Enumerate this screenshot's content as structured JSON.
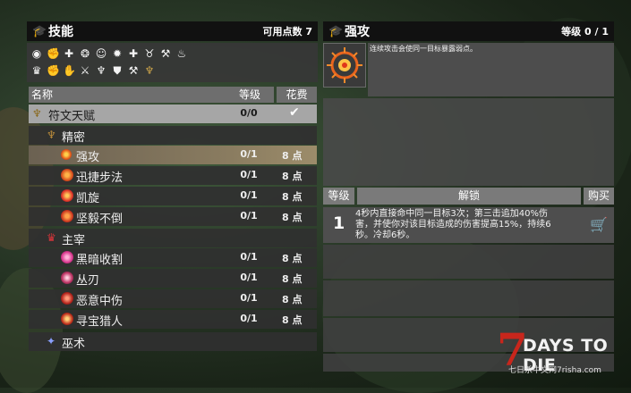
{
  "skills_panel": {
    "title": "技能",
    "points_label": "可用点数 7",
    "category_icons": [
      "eye-icon",
      "flex-arm-icon",
      "medical-cross-icon",
      "brain-icon",
      "head-gear-icon",
      "gear-icon",
      "medical-plus-icon",
      "cow-icon",
      "pickaxe-icon",
      "flame-icon",
      "hat-icon",
      "fist-icon",
      "fist-up-icon",
      "hammer-strike-icon",
      "grass-icon",
      "shield-icon",
      "hammer-icon",
      "rune-icon"
    ],
    "columns": {
      "name": "名称",
      "level": "等级",
      "cost": "花费"
    },
    "rows": [
      {
        "name": "符文天赋",
        "level": "0/0",
        "cost": "",
        "kind": "attribute",
        "icon": "rune-icon"
      },
      {
        "name": "精密",
        "level": "",
        "cost": "",
        "kind": "skill",
        "icon": "rune-small-icon"
      },
      {
        "name": "强攻",
        "level": "0/1",
        "cost": "8 点",
        "kind": "perk",
        "icon": "sun-sigil-icon",
        "selected": true
      },
      {
        "name": "迅捷步法",
        "level": "0/1",
        "cost": "8 点",
        "kind": "perk",
        "icon": "lightning-icon"
      },
      {
        "name": "凯旋",
        "level": "0/1",
        "cost": "8 点",
        "kind": "perk",
        "icon": "triumph-icon"
      },
      {
        "name": "坚毅不倒",
        "level": "0/1",
        "cost": "8 点",
        "kind": "perk",
        "icon": "figure-icon"
      },
      {
        "name": "主宰",
        "level": "",
        "cost": "",
        "kind": "skill",
        "icon": "domination-icon"
      },
      {
        "name": "黑暗收割",
        "level": "0/1",
        "cost": "8 点",
        "kind": "perk",
        "icon": "flame-pink-icon"
      },
      {
        "name": "丛刃",
        "level": "0/1",
        "cost": "8 点",
        "kind": "perk",
        "icon": "swirl-icon"
      },
      {
        "name": "恶意中伤",
        "level": "0/1",
        "cost": "8 点",
        "kind": "perk",
        "icon": "malice-icon"
      },
      {
        "name": "寻宝猎人",
        "level": "0/1",
        "cost": "8 点",
        "kind": "perk",
        "icon": "treasure-icon"
      },
      {
        "name": "巫术",
        "level": "",
        "cost": "",
        "kind": "skill",
        "icon": "sorcery-icon"
      }
    ]
  },
  "detail_panel": {
    "title": "强攻",
    "level_label": "等级 0 / 1",
    "description": "连续攻击会使同一目标暴露弱点。",
    "columns": {
      "level": "等级",
      "unlock": "解锁",
      "buy": "购买"
    },
    "unlock_rows": [
      {
        "level": "1",
        "text": "4秒内直接命中同一目标3次；第三击追加40%伤害，并使你对该目标造成的伤害提高15%，持续6秒。冷却6秒。"
      }
    ]
  },
  "logo": {
    "number": "7",
    "text": "DAYS TO DIE",
    "subtitle": "七日杀中文网7risha.com"
  },
  "colors": {
    "selected_row": "#8a7c60",
    "attribute_row": "#a6a6a6",
    "header": "#111111",
    "logo_red": "#c8261c"
  }
}
